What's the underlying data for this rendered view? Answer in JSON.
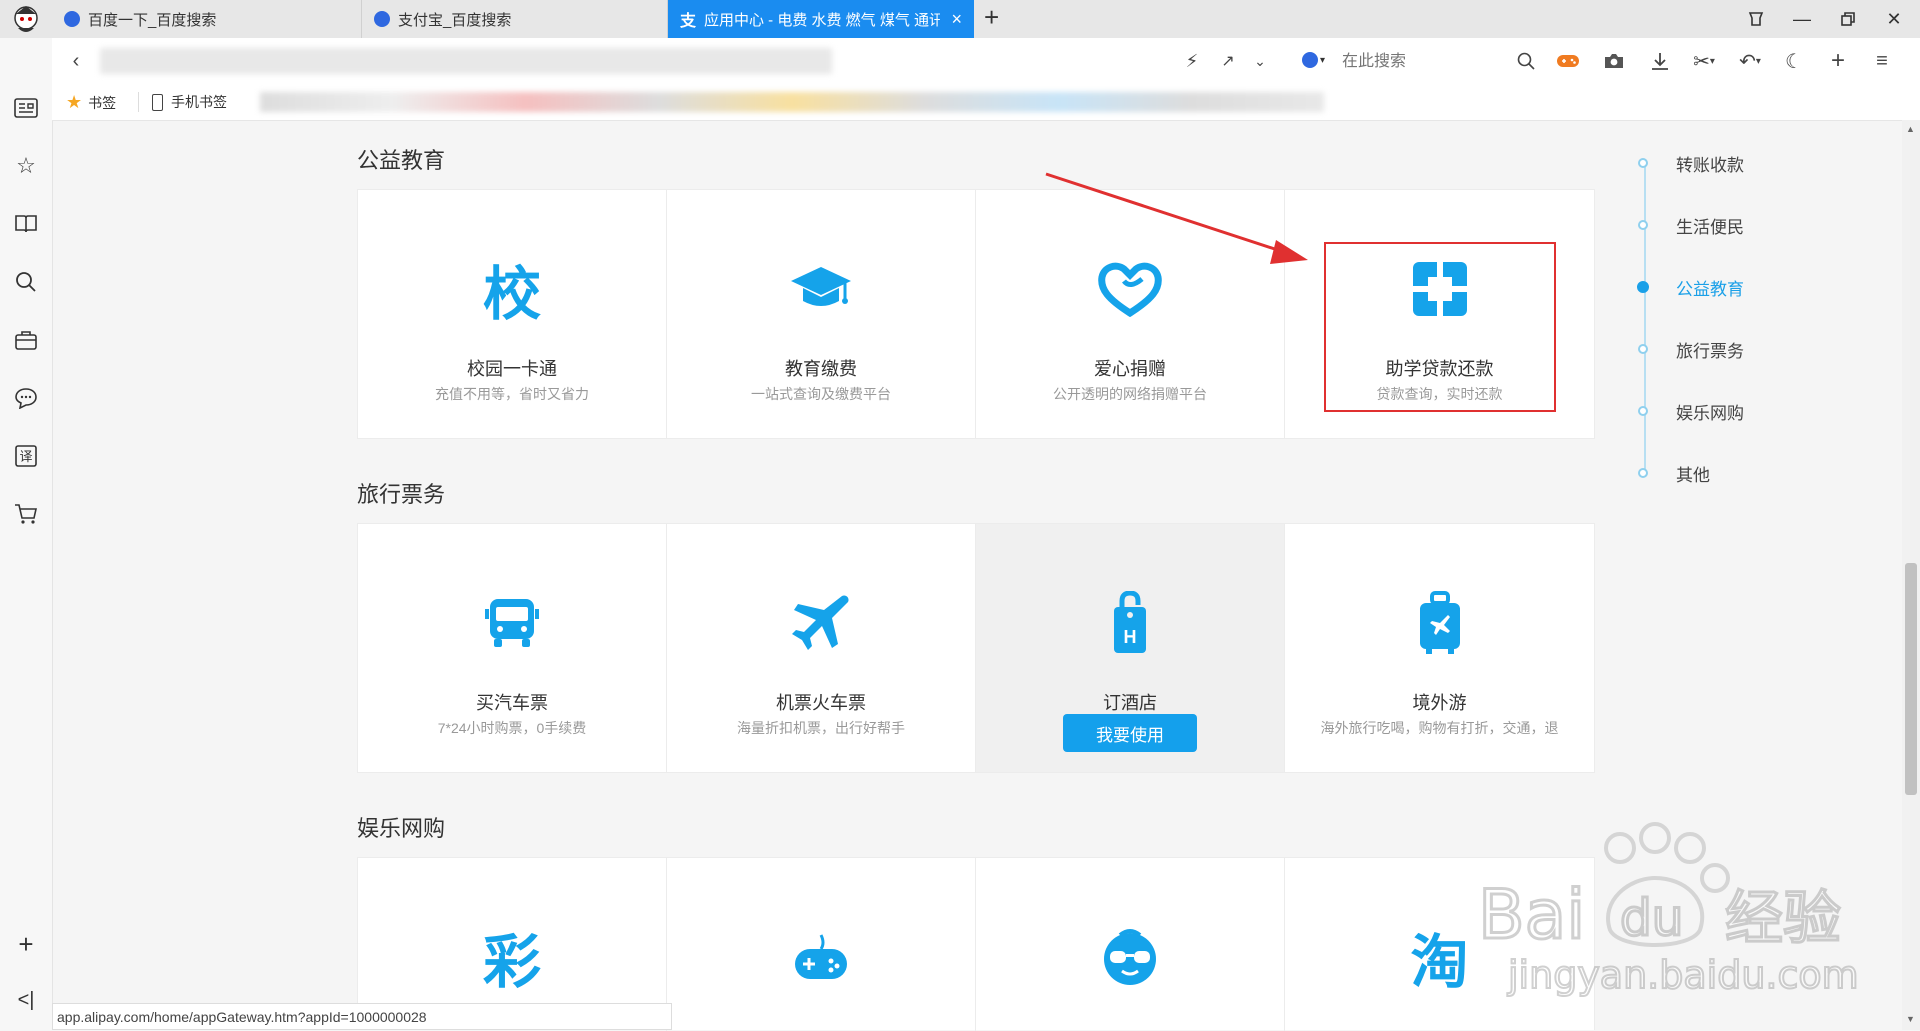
{
  "tabs": [
    {
      "label": "百度一下_百度搜索"
    },
    {
      "label": "支付宝_百度搜索"
    },
    {
      "label": "应用中心 - 电费 水费 燃气 煤气 通讯"
    }
  ],
  "new_tab_symbol": "+",
  "address_bar": {
    "search_placeholder": "在此搜索"
  },
  "bookmarks": {
    "bookmarks_label": "书签",
    "mobile_bookmarks_label": "手机书签"
  },
  "sections": [
    {
      "title": "公益教育",
      "cards": [
        {
          "icon_text": "校",
          "icon": "campus-char-icon",
          "name": "校园一卡通",
          "desc": "充值不用等，省时又省力"
        },
        {
          "icon": "graduation-cap-icon",
          "name": "教育缴费",
          "desc": "一站式查询及缴费平台"
        },
        {
          "icon": "heart-icon",
          "name": "爱心捐赠",
          "desc": "公开透明的网络捐赠平台"
        },
        {
          "icon": "student-loan-icon",
          "name": "助学贷款还款",
          "desc": "贷款查询，实时还款"
        }
      ]
    },
    {
      "title": "旅行票务",
      "cards": [
        {
          "icon": "bus-icon",
          "name": "买汽车票",
          "desc": "7*24小时购票，0手续费"
        },
        {
          "icon": "airplane-icon",
          "name": "机票火车票",
          "desc": "海量折扣机票，出行好帮手"
        },
        {
          "icon": "hotel-tag-icon",
          "icon_text": "H",
          "name": "订酒店",
          "button": "我要使用"
        },
        {
          "icon": "luggage-icon",
          "name": "境外游",
          "desc": "海外旅行吃喝，购物有打折，交通，退"
        }
      ]
    },
    {
      "title": "娱乐网购",
      "cards": [
        {
          "icon_text": "彩",
          "icon": "lottery-char-icon"
        },
        {
          "icon": "gamepad-icon"
        },
        {
          "icon": "taobao-movie-icon"
        },
        {
          "icon_text": "淘",
          "icon": "taobao-char-icon"
        }
      ]
    }
  ],
  "right_nav": [
    {
      "label": "转账收款",
      "active": false
    },
    {
      "label": "生活便民",
      "active": false
    },
    {
      "label": "公益教育",
      "active": true
    },
    {
      "label": "旅行票务",
      "active": false
    },
    {
      "label": "娱乐网购",
      "active": false
    },
    {
      "label": "其他",
      "active": false
    }
  ],
  "status_url": "app.alipay.com/home/appGateway.htm?appId=1000000028",
  "watermark": {
    "brand": "Bai du 经验",
    "url": "jingyan.baidu.com"
  },
  "colors": {
    "accent": "#1aa0e8",
    "tab_active": "#1a8cf0",
    "highlight": "#e03030",
    "icon_blue": "#15a3ea"
  }
}
